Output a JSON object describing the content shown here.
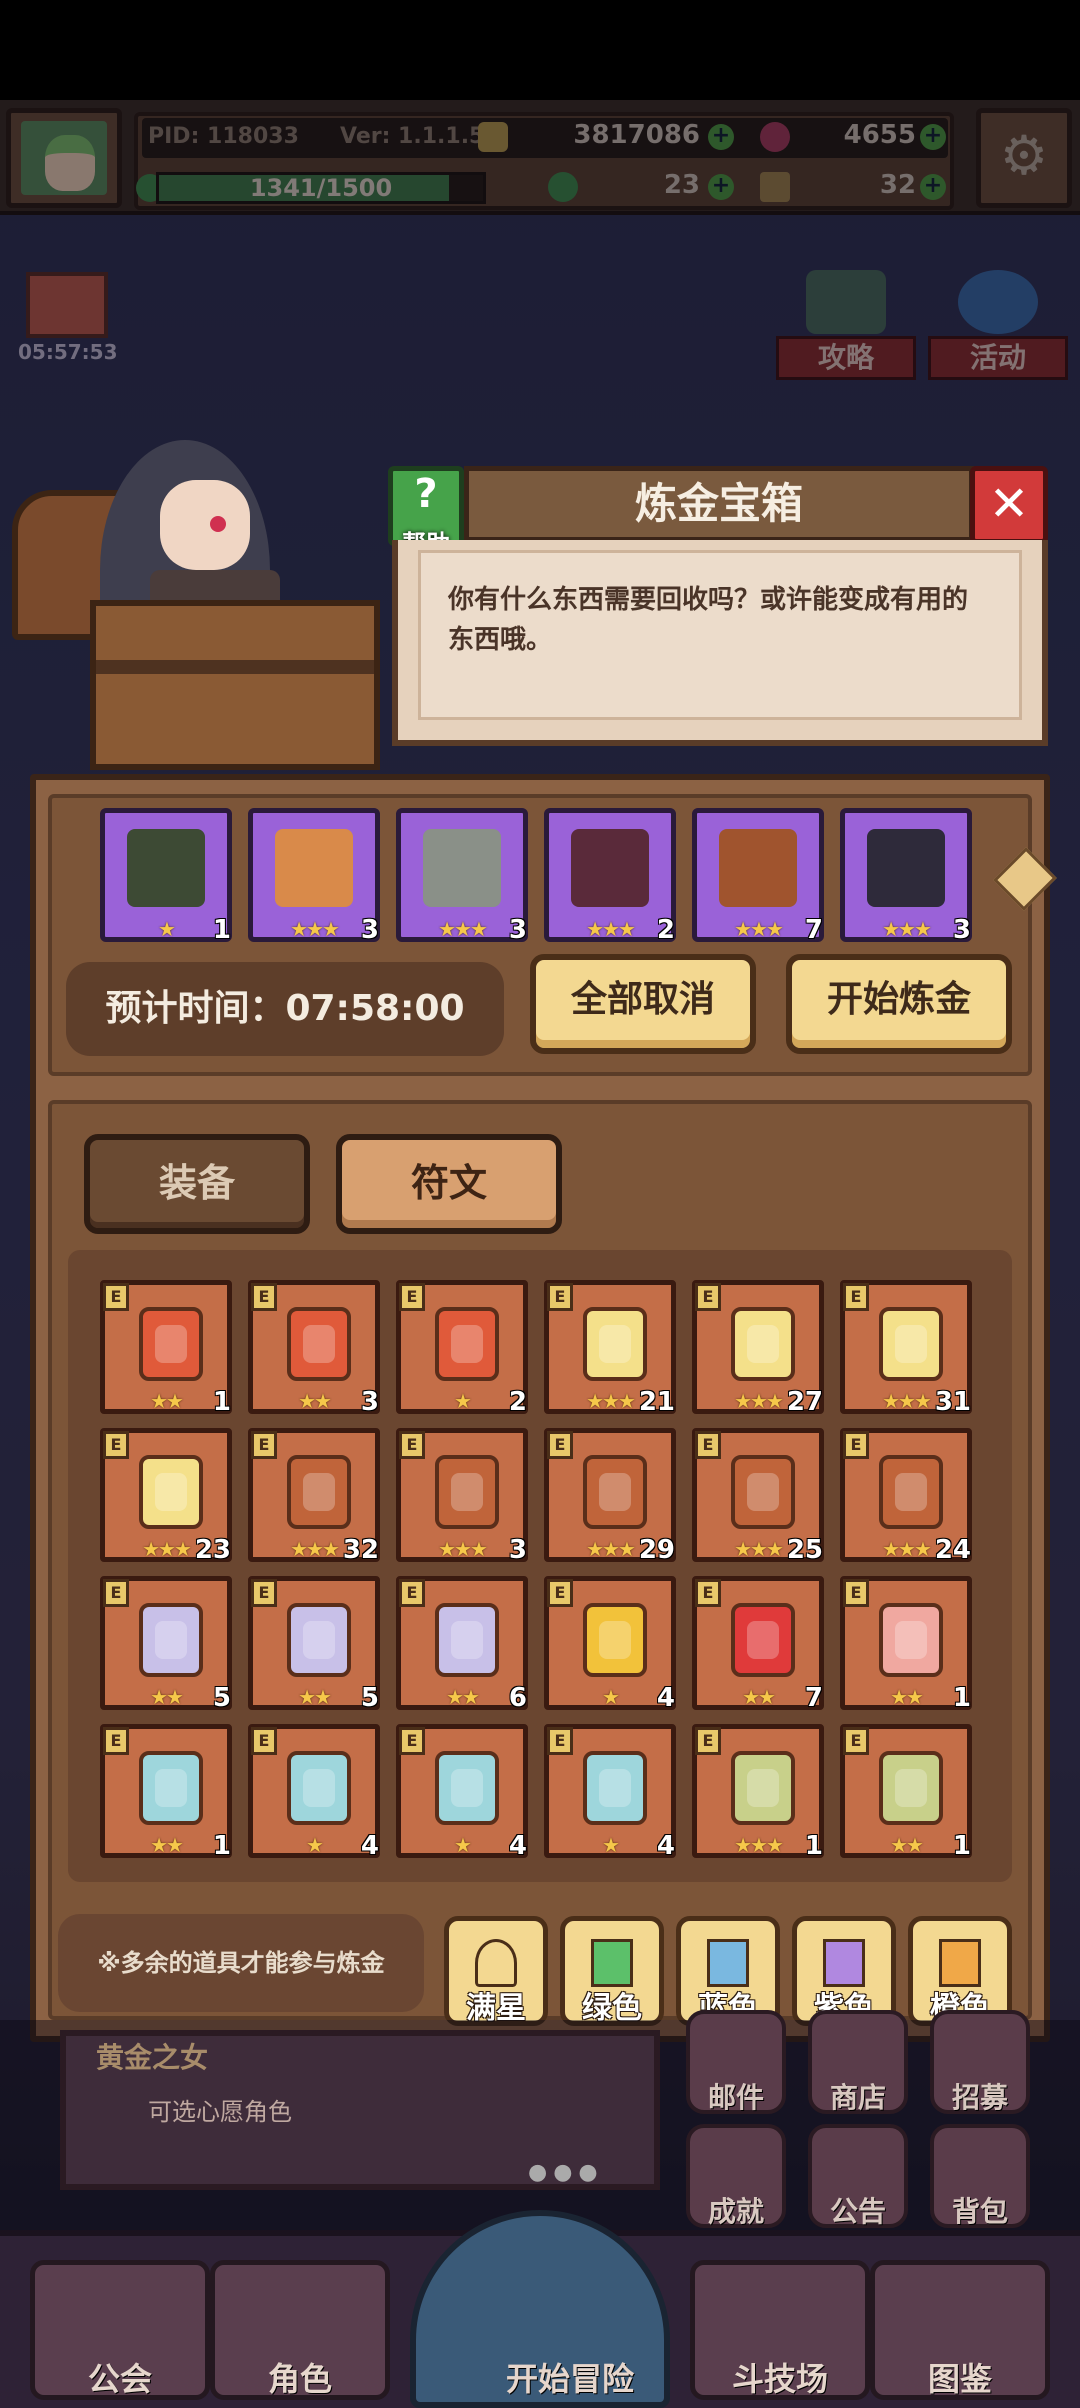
{
  "header": {
    "pid": "PID: 118033",
    "version": "Ver: 1.1.1.5",
    "gold": "3817086",
    "gems": "4655",
    "xp": "1341/1500",
    "xp_fraction": 0.894,
    "clover": "23",
    "key": "32"
  },
  "side": {
    "gift_timer": "05:57:53",
    "guide_label": "攻略",
    "event_label": "活动"
  },
  "dialog": {
    "title": "炼金宝箱",
    "help_label": "帮助",
    "message": "你有什么东西需要回收吗？或许能变成有用的东西哦。"
  },
  "selected": [
    {
      "icon": "helmet-icon",
      "stars": "★",
      "count": "1",
      "color": "#3d4a34"
    },
    {
      "icon": "chest-armor-icon",
      "stars": "★★★",
      "count": "3",
      "color": "#d98a4a"
    },
    {
      "icon": "plate-armor-icon",
      "stars": "★★★",
      "count": "3",
      "color": "#8a9088"
    },
    {
      "icon": "boot-icon",
      "stars": "★★★",
      "count": "2",
      "color": "#5a2a3a"
    },
    {
      "icon": "boot-icon",
      "stars": "★★★",
      "count": "7",
      "color": "#a0542e"
    },
    {
      "icon": "boot-icon",
      "stars": "★★★",
      "count": "3",
      "color": "#2e2a3a"
    }
  ],
  "alchemy": {
    "estimate": "预计时间：07:58:00",
    "cancel_all": "全部取消",
    "start": "开始炼金"
  },
  "tabs": {
    "equipment": "装备",
    "runes": "符文"
  },
  "runes": [
    {
      "stars": "★★",
      "count": "1",
      "color": "#e05a3a"
    },
    {
      "stars": "★★",
      "count": "3",
      "color": "#e05a3a"
    },
    {
      "stars": "★",
      "count": "2",
      "color": "#e05a3a"
    },
    {
      "stars": "★★★",
      "count": "21",
      "color": "#f4e08a"
    },
    {
      "stars": "★★★",
      "count": "27",
      "color": "#f4e08a"
    },
    {
      "stars": "★★★",
      "count": "31",
      "color": "#f4e08a"
    },
    {
      "stars": "★★★",
      "count": "23",
      "color": "#f4e08a"
    },
    {
      "stars": "★★★",
      "count": "32",
      "color": "#c0643a"
    },
    {
      "stars": "★★★",
      "count": "3",
      "color": "#c0643a"
    },
    {
      "stars": "★★★",
      "count": "29",
      "color": "#c0643a"
    },
    {
      "stars": "★★★",
      "count": "25",
      "color": "#c0643a"
    },
    {
      "stars": "★★★",
      "count": "24",
      "color": "#c0643a"
    },
    {
      "stars": "★★",
      "count": "5",
      "color": "#c8c0e8"
    },
    {
      "stars": "★★",
      "count": "5",
      "color": "#c8c0e8"
    },
    {
      "stars": "★★",
      "count": "6",
      "color": "#c8c0e8"
    },
    {
      "stars": "★",
      "count": "4",
      "color": "#f2c23a"
    },
    {
      "stars": "★★",
      "count": "7",
      "color": "#e03a3a"
    },
    {
      "stars": "★★",
      "count": "1",
      "color": "#f0a8a0"
    },
    {
      "stars": "★★",
      "count": "1",
      "color": "#9ed6dc"
    },
    {
      "stars": "★",
      "count": "4",
      "color": "#9ed6dc"
    },
    {
      "stars": "★",
      "count": "4",
      "color": "#9ed6dc"
    },
    {
      "stars": "★",
      "count": "4",
      "color": "#9ed6dc"
    },
    {
      "stars": "★★★",
      "count": "1",
      "color": "#c8d08a"
    },
    {
      "stars": "★★",
      "count": "1",
      "color": "#c8d08a"
    }
  ],
  "rune_badge": "E",
  "footer": {
    "note": "※多余的道具才能参与炼金",
    "filters": [
      {
        "label": "满星",
        "color": "#f3d891"
      },
      {
        "label": "绿色",
        "color": "#5cc06a"
      },
      {
        "label": "蓝色",
        "color": "#7ab8e0"
      },
      {
        "label": "紫色",
        "color": "#b088e0"
      },
      {
        "label": "橙色",
        "color": "#f0a848"
      }
    ]
  },
  "background": {
    "banner_title": "黄金之女",
    "banner_sub": "可选心愿角色",
    "menu": [
      "邮件",
      "商店",
      "招募",
      "成就",
      "公告",
      "背包"
    ],
    "nav": [
      "公会",
      "角色",
      "开始冒险",
      "斗技场",
      "图鉴"
    ]
  }
}
